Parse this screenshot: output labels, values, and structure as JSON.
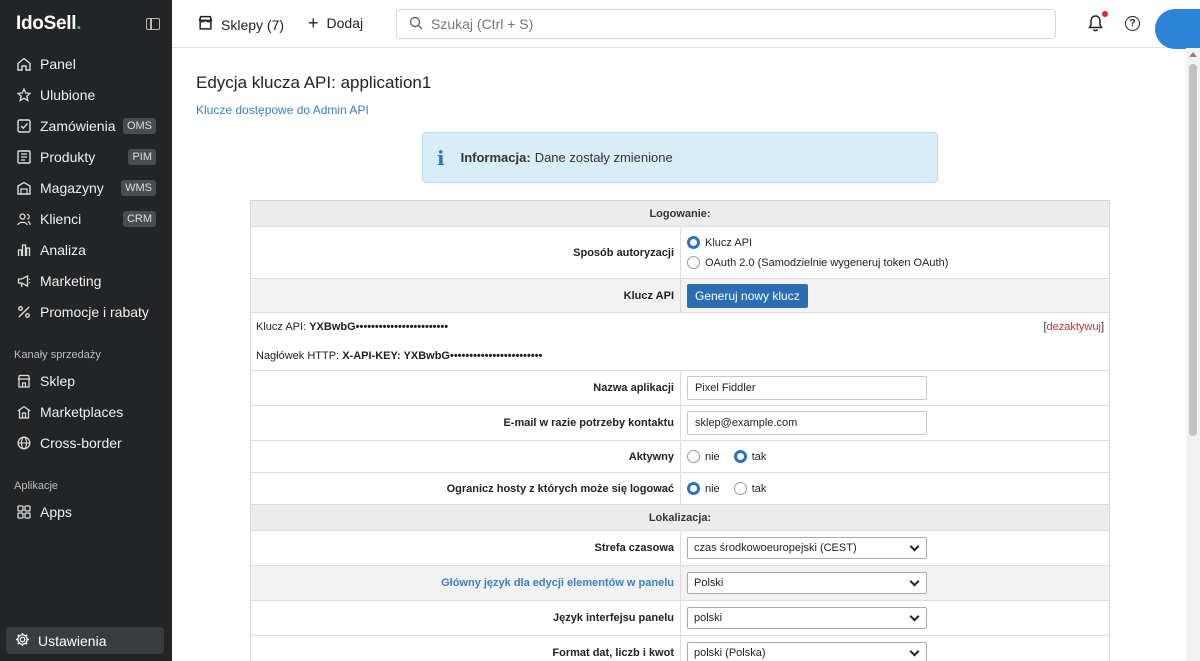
{
  "sidebar": {
    "logo": "IdoSell",
    "items": [
      {
        "label": "Panel",
        "icon": "home-icon",
        "badge": ""
      },
      {
        "label": "Ulubione",
        "icon": "star-icon",
        "badge": ""
      },
      {
        "label": "Zamówienia",
        "icon": "checkbox-icon",
        "badge": "OMS"
      },
      {
        "label": "Produkty",
        "icon": "package-icon",
        "badge": "PIM"
      },
      {
        "label": "Magazyny",
        "icon": "warehouse-icon",
        "badge": "WMS"
      },
      {
        "label": "Klienci",
        "icon": "users-icon",
        "badge": "CRM"
      },
      {
        "label": "Analiza",
        "icon": "chart-icon",
        "badge": ""
      },
      {
        "label": "Marketing",
        "icon": "megaphone-icon",
        "badge": ""
      },
      {
        "label": "Promocje i rabaty",
        "icon": "percent-icon",
        "badge": ""
      }
    ],
    "section_sales": "Kanały sprzedaży",
    "sales_items": [
      {
        "label": "Sklep",
        "icon": "store-icon"
      },
      {
        "label": "Marketplaces",
        "icon": "marketplace-icon"
      },
      {
        "label": "Cross-border",
        "icon": "globe-icon"
      }
    ],
    "section_apps": "Aplikacje",
    "apps_items": [
      {
        "label": "Apps",
        "icon": "apps-icon"
      }
    ],
    "settings": "Ustawienia"
  },
  "topbar": {
    "shops": "Sklepy (7)",
    "add": "Dodaj",
    "search_placeholder": "Szukaj (Ctrl + S)"
  },
  "page": {
    "title": "Edycja klucza API: application1",
    "sublink": "Klucze dostępowe do Admin API",
    "info_label": "Informacja:",
    "info_message": "Dane zostały zmienione"
  },
  "form": {
    "section_login": "Logowanie:",
    "auth_method_label": "Sposób autoryzacji",
    "auth_options": [
      "Klucz API",
      "OAuth 2.0 (Samodzielnie wygeneruj token OAuth)"
    ],
    "auth_selected": "Klucz API",
    "api_key_label": "Klucz API",
    "generate_button": "Generuj nowy klucz",
    "api_key_prefix": "Klucz API:",
    "api_key_value": "YXBwbG••••••••••••••••••••••••",
    "deactivate": "dezaktywuj",
    "header_prefix": "Nagłówek HTTP:",
    "header_value": "X-API-KEY: YXBwbG••••••••••••••••••••••••",
    "app_name_label": "Nazwa aplikacji",
    "app_name_value": "Pixel Fiddler",
    "email_label": "E-mail w razie potrzeby kontaktu",
    "email_value": "sklep@example.com",
    "active_label": "Aktywny",
    "active_no": "nie",
    "active_yes": "tak",
    "active_selected": "tak",
    "limit_hosts_label": "Ogranicz hosty z których może się logować",
    "limit_no": "nie",
    "limit_yes": "tak",
    "limit_selected": "nie",
    "section_localization": "Lokalizacja:",
    "timezone_label": "Strefa czasowa",
    "timezone_value": "czas środkowoeuropejski (CEST)",
    "main_lang_label": "Główny język dla edycji elementów w panelu",
    "main_lang_value": "Polski",
    "ui_lang_label": "Język interfejsu panelu",
    "ui_lang_value": "polski",
    "format_label": "Format dat, liczb i kwot",
    "format_value": "polski (Polska)"
  },
  "colors": {
    "sidebar_bg": "#222426",
    "accent": "#2a6db3",
    "info_bg": "#d7eef8",
    "link": "#3a7fc1",
    "danger": "#c9302c"
  }
}
